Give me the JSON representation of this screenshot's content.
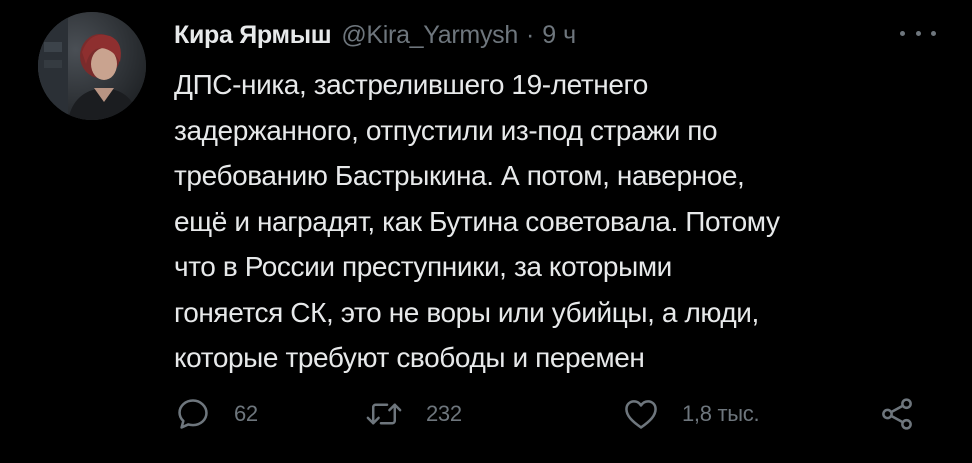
{
  "tweet": {
    "author_name": "Кира Ярмыш",
    "author_handle": "@Kira_Yarmysh",
    "separator": "·",
    "time": "9 ч",
    "text_lines": [
      "ДПС-ника, застрелившего 19-летнего",
      "задержанного, отпустили из-под стражи по",
      "требованию Бастрыкина. А потом, наверное,",
      "ещё и наградят, как Бутина советовала. Потому",
      "что в России преступники, за которыми",
      "гоняется СК, это не воры или убийцы, а люди,",
      "которые требуют свободы и перемен"
    ]
  },
  "actions": {
    "reply": {
      "icon": "reply-icon",
      "count": "62"
    },
    "retweet": {
      "icon": "retweet-icon",
      "count": "232"
    },
    "like": {
      "icon": "heart-icon",
      "count": "1,8 тыс."
    },
    "share": {
      "icon": "share-icon"
    }
  },
  "colors": {
    "background": "#000000",
    "text_primary": "#e7e9ea",
    "text_secondary": "#6e767d"
  }
}
